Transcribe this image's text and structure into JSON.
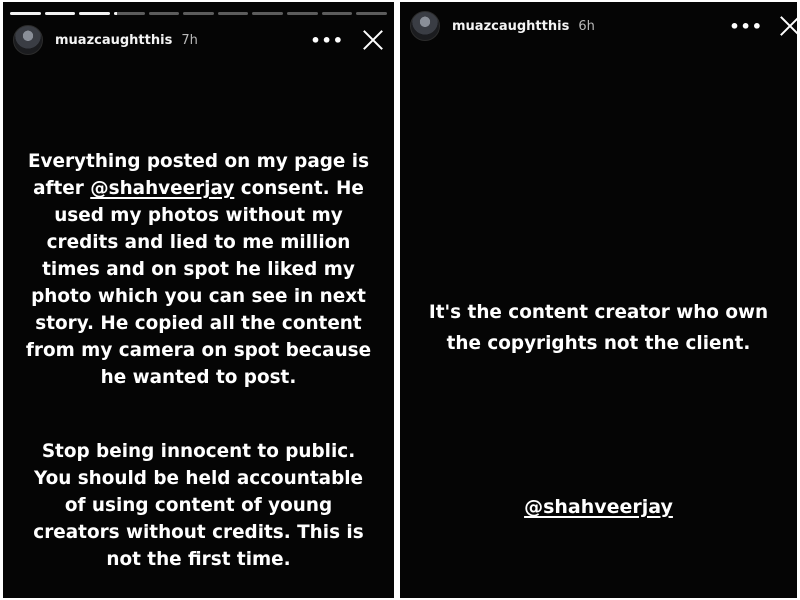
{
  "left_story": {
    "username": "muazcaughtthis",
    "timestamp": "7h",
    "more_icon": "•••",
    "progress": [
      1,
      1,
      1,
      0.1,
      0,
      0,
      0,
      0,
      0,
      0,
      0
    ],
    "paragraph1": {
      "before_mention": "Everything posted on my page is after ",
      "mention": "@shahveerjay",
      "after_mention": " consent. He used my photos without my credits and lied to me million times and on spot he liked my photo which you can see in next story. He copied all the content from my camera on spot because he wanted to post."
    },
    "paragraph2": "Stop being innocent to public. You should be held accountable of using content of young creators without credits. This is not the first time."
  },
  "right_story": {
    "username": "muazcaughtthis",
    "timestamp": "6h",
    "more_icon": "•••",
    "text": "It's the content creator who own the copyrights not the client.",
    "mention": "@shahveerjay"
  },
  "colors": {
    "story_background": "#050505",
    "text": "#ffffff",
    "timestamp": "#b9b9b9"
  }
}
